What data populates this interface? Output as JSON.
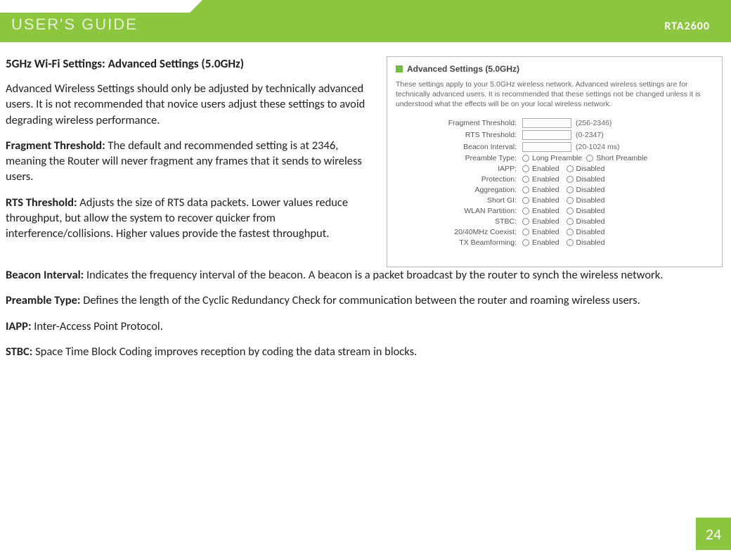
{
  "header": {
    "title": "USER'S GUIDE",
    "model": "RTA2600"
  },
  "page_number": "24",
  "section_title": "5GHz Wi-Fi Settings: Advanced Settings (5.0GHz)",
  "intro": "Advanced Wireless Settings should only be adjusted by technically advanced users. It is not recommended that novice users adjust these settings to avoid degrading wireless performance.",
  "items": {
    "fragment": {
      "label": "Fragment Threshold:",
      "text": " The default and recommended setting is at 2346, meaning the Router will never fragment any frames that it sends to wireless users."
    },
    "rts": {
      "label": "RTS Threshold:",
      "text": " Adjusts the size of RTS data packets. Lower values reduce throughput, but allow the system to recover quicker from interference/collisions. Higher values provide the fastest throughput."
    },
    "beacon": {
      "label": "Beacon Interval:",
      "text": " Indicates the frequency interval of the beacon. A beacon is a packet broadcast by the router to synch the wireless network."
    },
    "preamble": {
      "label": "Preamble Type:",
      "text": " Defines the length of the Cyclic Redundancy Check for communication between the router and roaming wireless users."
    },
    "iapp": {
      "label": "IAPP:",
      "text": " Inter-Access Point Protocol."
    },
    "stbc": {
      "label": "STBC:",
      "text": " Space Time Block Coding improves reception by coding the data stream in blocks."
    }
  },
  "screenshot": {
    "title": "Advanced Settings (5.0GHz)",
    "desc": "These settings apply to your 5.0GHz wireless network. Advanced wireless settings are for technically advanced users. It is recommended that these settings not be changed unless it is understood what the effects will be on your local wireless network.",
    "fields": {
      "fragment": {
        "label": "Fragment Threshold:",
        "hint": "(256-2346)"
      },
      "rts": {
        "label": "RTS Threshold:",
        "hint": "(0-2347)"
      },
      "beacon": {
        "label": "Beacon Interval:",
        "hint": "(20-1024 ms)"
      },
      "preamble": {
        "label": "Preamble Type:",
        "opt1": "Long Preamble",
        "opt2": "Short Preamble"
      },
      "iapp": {
        "label": "IAPP:",
        "opt1": "Enabled",
        "opt2": "Disabled"
      },
      "protection": {
        "label": "Protection:",
        "opt1": "Enabled",
        "opt2": "Disabled"
      },
      "aggregation": {
        "label": "Aggregation:",
        "opt1": "Enabled",
        "opt2": "Disabled"
      },
      "shortgi": {
        "label": "Short GI:",
        "opt1": "Enabled",
        "opt2": "Disabled"
      },
      "wlan": {
        "label": "WLAN Partition:",
        "opt1": "Enabled",
        "opt2": "Disabled"
      },
      "stbc": {
        "label": "STBC:",
        "opt1": "Enabled",
        "opt2": "Disabled"
      },
      "coexist": {
        "label": "20/40MHz Coexist:",
        "opt1": "Enabled",
        "opt2": "Disabled"
      },
      "txbeam": {
        "label": "TX Beamforming:",
        "opt1": "Enabled",
        "opt2": "Disabled"
      }
    }
  }
}
